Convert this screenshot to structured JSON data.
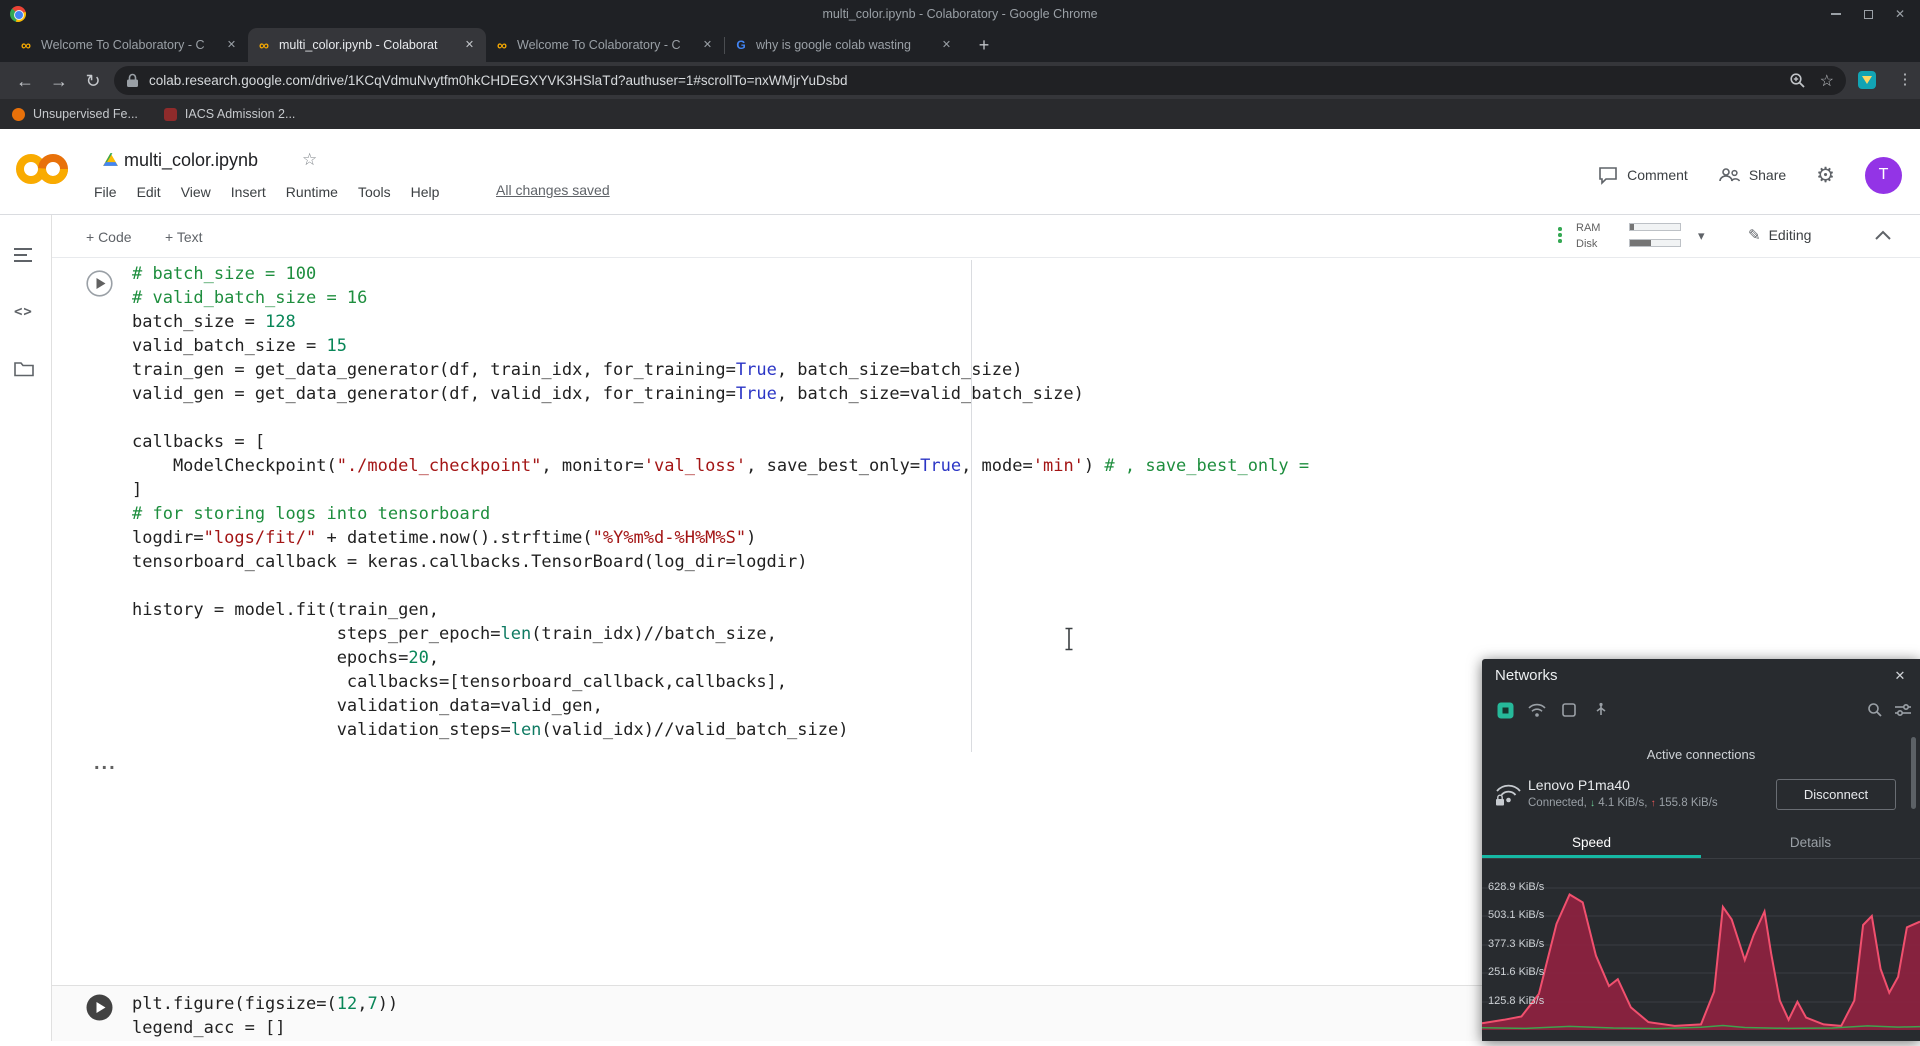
{
  "colors": {
    "accent_teal": "#16b8a4",
    "chart_line": "#f1506e",
    "chart_fill": "#8e2240",
    "upload_line": "#3fa34d",
    "avatar_bg": "#9334e6",
    "connect_green": "#34a853"
  },
  "window": {
    "title": "multi_color.ipynb - Colaboratory - Google Chrome"
  },
  "browser": {
    "tabs": [
      {
        "label": "Welcome To Colaboratory - C",
        "icon": "colab",
        "active": false
      },
      {
        "label": "multi_color.ipynb - Colaborat",
        "icon": "colab",
        "active": true
      },
      {
        "label": "Welcome To Colaboratory - C",
        "icon": "colab",
        "active": false
      },
      {
        "label": "why is google colab wasting",
        "icon": "google",
        "active": false
      }
    ],
    "url": "colab.research.google.com/drive/1KCqVdmuNvytfm0hkCHDEGXYVK3HSlaTd?authuser=1#scrollTo=nxWMjrYuDsbd",
    "bookmarks": [
      {
        "label": "Unsupervised Fe..."
      },
      {
        "label": "IACS Admission 2..."
      }
    ]
  },
  "colab": {
    "notebook_title": "multi_color.ipynb",
    "menu": [
      "File",
      "Edit",
      "View",
      "Insert",
      "Runtime",
      "Tools",
      "Help"
    ],
    "changes_saved": "All changes saved",
    "comment_label": "Comment",
    "share_label": "Share",
    "avatar_initial": "T",
    "toolbar": {
      "add_code": "+ Code",
      "add_text": "+ Text",
      "ram_label": "RAM",
      "disk_label": "Disk",
      "editing_label": "Editing",
      "ram_fill_pct": 7,
      "disk_fill_pct": 42
    },
    "collapsed_output": "..."
  },
  "code_cells": [
    {
      "lines": [
        [
          {
            "t": "# batch_size = 100",
            "c": "cm"
          }
        ],
        [
          {
            "t": "# valid_batch_size = 16",
            "c": "cm"
          }
        ],
        [
          {
            "t": "batch_size = ",
            "c": "pl"
          },
          {
            "t": "128",
            "c": "nu"
          }
        ],
        [
          {
            "t": "valid_batch_size = ",
            "c": "pl"
          },
          {
            "t": "15",
            "c": "nu"
          }
        ],
        [
          {
            "t": "train_gen = get_data_generator(df, train_idx, for_training=",
            "c": "pl"
          },
          {
            "t": "True",
            "c": "kw"
          },
          {
            "t": ", batch_size=batch_size)",
            "c": "pl"
          }
        ],
        [
          {
            "t": "valid_gen = get_data_generator(df, valid_idx, for_training=",
            "c": "pl"
          },
          {
            "t": "True",
            "c": "kw"
          },
          {
            "t": ", batch_size=valid_batch_size)",
            "c": "pl"
          }
        ],
        [],
        [
          {
            "t": "callbacks = [",
            "c": "pl"
          }
        ],
        [
          {
            "t": "    ModelCheckpoint(",
            "c": "pl"
          },
          {
            "t": "\"./model_checkpoint\"",
            "c": "st"
          },
          {
            "t": ", monitor=",
            "c": "pl"
          },
          {
            "t": "'val_loss'",
            "c": "st"
          },
          {
            "t": ", save_best_only=",
            "c": "pl"
          },
          {
            "t": "True",
            "c": "kw"
          },
          {
            "t": ", mode=",
            "c": "pl"
          },
          {
            "t": "'min'",
            "c": "st"
          },
          {
            "t": ") ",
            "c": "pl"
          },
          {
            "t": "# , save_best_only =",
            "c": "cm"
          }
        ],
        [
          {
            "t": "]",
            "c": "pl"
          }
        ],
        [
          {
            "t": "# for storing logs into tensorboard",
            "c": "cm"
          }
        ],
        [
          {
            "t": "logdir=",
            "c": "pl"
          },
          {
            "t": "\"logs/fit/\"",
            "c": "st"
          },
          {
            "t": " + datetime.now().strftime(",
            "c": "pl"
          },
          {
            "t": "\"%Y%m%d-%H%M%S\"",
            "c": "st"
          },
          {
            "t": ")",
            "c": "pl"
          }
        ],
        [
          {
            "t": "tensorboard_callback = keras.callbacks.TensorBoard(log_dir=logdir)",
            "c": "pl"
          }
        ],
        [],
        [
          {
            "t": "history = model.fit(train_gen,",
            "c": "pl"
          }
        ],
        [
          {
            "t": "                    steps_per_epoch=",
            "c": "pl"
          },
          {
            "t": "len",
            "c": "bi"
          },
          {
            "t": "(train_idx)//batch_size,",
            "c": "pl"
          }
        ],
        [
          {
            "t": "                    epochs=",
            "c": "pl"
          },
          {
            "t": "20",
            "c": "nu"
          },
          {
            "t": ",",
            "c": "pl"
          }
        ],
        [
          {
            "t": "                     callbacks=[tensorboard_callback,callbacks],",
            "c": "pl"
          }
        ],
        [
          {
            "t": "                    validation_data=valid_gen,",
            "c": "pl"
          }
        ],
        [
          {
            "t": "                    validation_steps=",
            "c": "pl"
          },
          {
            "t": "len",
            "c": "bi"
          },
          {
            "t": "(valid_idx)//valid_batch_size)",
            "c": "pl"
          }
        ]
      ]
    },
    {
      "lines": [
        [
          {
            "t": "plt.figure(figsize=(",
            "c": "pl"
          },
          {
            "t": "12",
            "c": "nu"
          },
          {
            "t": ",",
            "c": "pl"
          },
          {
            "t": "7",
            "c": "nu"
          },
          {
            "t": "))",
            "c": "pl"
          }
        ],
        [
          {
            "t": "legend_acc = []",
            "c": "pl"
          }
        ]
      ]
    }
  ],
  "networks": {
    "title": "Networks",
    "active_connections_label": "Active connections",
    "connection": {
      "name": "Lenovo P1ma40",
      "status_prefix": "Connected,",
      "down_speed": "4.1 KiB/s,",
      "up_speed": "155.8 KiB/s",
      "disconnect_label": "Disconnect"
    },
    "tabs": [
      {
        "label": "Speed",
        "active": true
      },
      {
        "label": "Details",
        "active": false
      }
    ],
    "chart_data": {
      "type": "area",
      "unit": "KiB/s",
      "y_ticks": [
        "628.9 KiB/s",
        "503.1 KiB/s",
        "377.3 KiB/s",
        "251.6 KiB/s",
        "125.8 KiB/s"
      ],
      "y_tick_values": [
        628.9,
        503.1,
        377.3,
        251.6,
        125.8
      ],
      "download_series": [
        [
          0,
          30
        ],
        [
          0.05,
          45
        ],
        [
          0.09,
          60
        ],
        [
          0.13,
          160
        ],
        [
          0.17,
          470
        ],
        [
          0.2,
          600
        ],
        [
          0.23,
          565
        ],
        [
          0.26,
          330
        ],
        [
          0.29,
          195
        ],
        [
          0.31,
          225
        ],
        [
          0.34,
          100
        ],
        [
          0.38,
          35
        ],
        [
          0.44,
          18
        ],
        [
          0.5,
          25
        ],
        [
          0.53,
          170
        ],
        [
          0.55,
          545
        ],
        [
          0.57,
          490
        ],
        [
          0.6,
          310
        ],
        [
          0.62,
          420
        ],
        [
          0.645,
          525
        ],
        [
          0.66,
          340
        ],
        [
          0.68,
          130
        ],
        [
          0.7,
          45
        ],
        [
          0.72,
          125
        ],
        [
          0.74,
          55
        ],
        [
          0.78,
          25
        ],
        [
          0.82,
          18
        ],
        [
          0.85,
          130
        ],
        [
          0.87,
          465
        ],
        [
          0.89,
          505
        ],
        [
          0.91,
          270
        ],
        [
          0.93,
          165
        ],
        [
          0.95,
          235
        ],
        [
          0.97,
          455
        ],
        [
          1,
          480
        ]
      ],
      "upload_series": [
        [
          0,
          10
        ],
        [
          0.1,
          7
        ],
        [
          0.2,
          16
        ],
        [
          0.3,
          9
        ],
        [
          0.4,
          6
        ],
        [
          0.5,
          12
        ],
        [
          0.55,
          20
        ],
        [
          0.6,
          11
        ],
        [
          0.7,
          7
        ],
        [
          0.8,
          9
        ],
        [
          0.88,
          18
        ],
        [
          0.95,
          13
        ],
        [
          1,
          15
        ]
      ]
    }
  }
}
